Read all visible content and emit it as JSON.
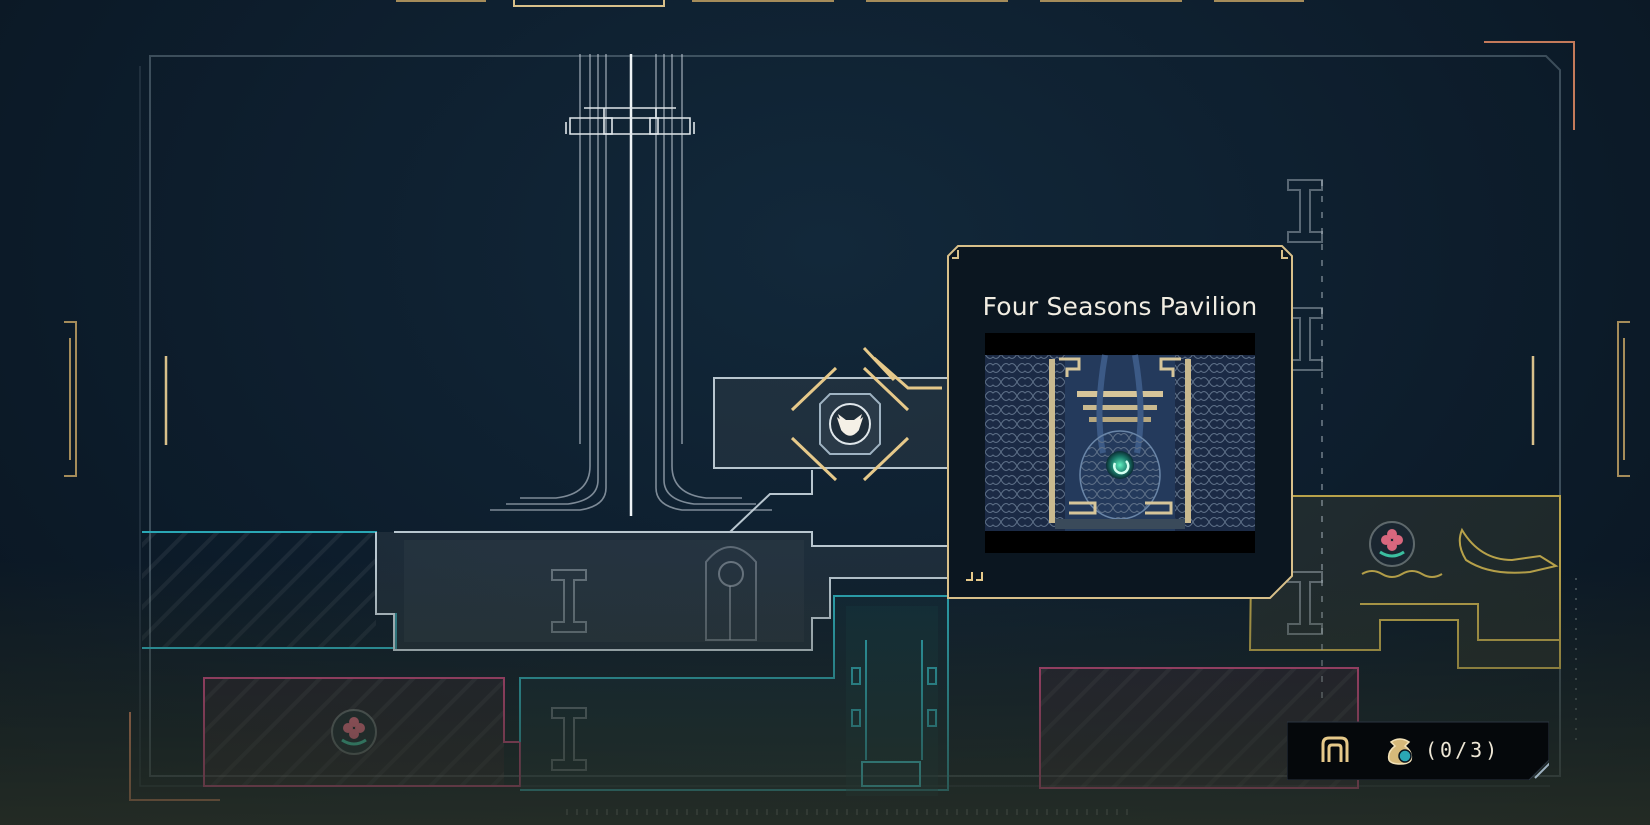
{
  "location": {
    "name": "Four Seasons Pavilion"
  },
  "collectibles": {
    "count_text": "(0/3)",
    "found": 0,
    "total": 3
  },
  "icons": {
    "player_marker": "cat-head-icon",
    "rooms": [
      "lotus-flower-icon",
      "lotus-flower-icon"
    ],
    "legend": [
      "gate-icon",
      "treasure-pouch-icon"
    ],
    "decor": [
      "koi-fish-icon"
    ]
  },
  "colors": {
    "background": "#0d1d2c",
    "map_line": "#9fb3c2",
    "gold": "#d8c08a",
    "teal_zone": "#2aa7b5",
    "pink_zone": "#c2447c",
    "gold_zone": "#b8a24a"
  }
}
